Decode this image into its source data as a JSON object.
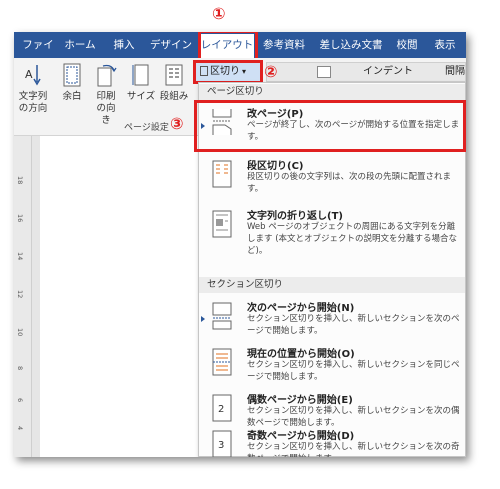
{
  "tabs": [
    {
      "label": "ファイル"
    },
    {
      "label": "ホーム"
    },
    {
      "label": "挿入"
    },
    {
      "label": "デザイン"
    },
    {
      "label": "レイアウト"
    },
    {
      "label": "参考資料"
    },
    {
      "label": "差し込み文書"
    },
    {
      "label": "校閲"
    },
    {
      "label": "表示"
    }
  ],
  "annotations": {
    "step1": "①",
    "step2": "②",
    "step3": "③"
  },
  "ribbon": {
    "text_direction": "文字列の方向",
    "margins": "余白",
    "orientation": "印刷の向き",
    "size": "サイズ",
    "columns": "段組み",
    "group_label": "ページ設定",
    "breaks_button": "区切り",
    "indent_label": "インデント",
    "spacing_label": "間隔",
    "dropdown_mark": "▾"
  },
  "ruler_numbers": [
    "18",
    "16",
    "14",
    "12",
    "10",
    "8",
    "6",
    "4",
    "2"
  ],
  "menu": {
    "page_breaks_header": "ページ区切り",
    "section_breaks_header": "セクション区切り",
    "items": [
      {
        "title": "改ページ(P)",
        "desc": "ページが終了し、次のページが開始する位置を指定します。"
      },
      {
        "title": "段区切り(C)",
        "desc": "段区切りの後の文字列は、次の段の先頭に配置されます。"
      },
      {
        "title": "文字列の折り返し(T)",
        "desc": "Web ページのオブジェクトの周囲にある文字列を分離します (本文とオブジェクトの説明文を分離する場合など)。"
      },
      {
        "title": "次のページから開始(N)",
        "desc": "セクション区切りを挿入し、新しいセクションを次のページで開始します。"
      },
      {
        "title": "現在の位置から開始(O)",
        "desc": "セクション区切りを挿入し、新しいセクションを同じページで開始します。"
      },
      {
        "title": "偶数ページから開始(E)",
        "desc": "セクション区切りを挿入し、新しいセクションを次の偶数ページで開始します。"
      },
      {
        "title": "奇数ページから開始(D)",
        "desc": "セクション区切りを挿入し、新しいセクションを次の奇数ページで開始します。"
      }
    ]
  },
  "colors": {
    "accent": "#2b579a",
    "highlight": "#e02020"
  }
}
